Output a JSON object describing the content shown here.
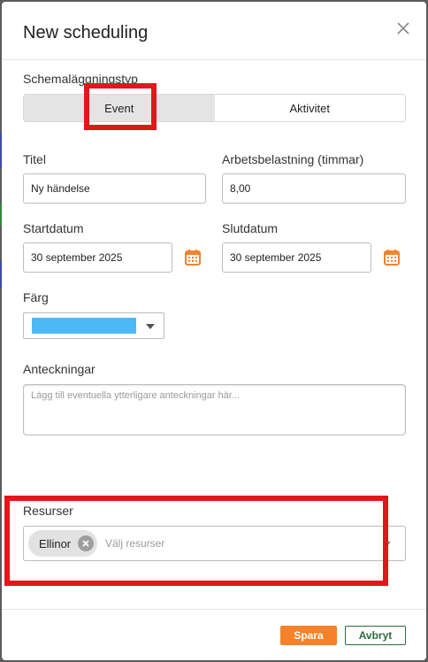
{
  "dialog": {
    "title": "New scheduling"
  },
  "schedule_type": {
    "label": "Schemaläggningstyp",
    "options": [
      "Event",
      "Aktivitet"
    ],
    "selected": "Event"
  },
  "title_field": {
    "label": "Titel",
    "value": "Ny händelse"
  },
  "workload_field": {
    "label": "Arbetsbelastning (timmar)",
    "value": "8,00"
  },
  "start_date_field": {
    "label": "Startdatum",
    "value": "30 september 2025"
  },
  "end_date_field": {
    "label": "Slutdatum",
    "value": "30 september 2025"
  },
  "color_field": {
    "label": "Färg",
    "selected_color": "#4db8f6"
  },
  "notes_field": {
    "label": "Anteckningar",
    "placeholder": "Lägg till eventuella ytterligare anteckningar här..."
  },
  "resources_field": {
    "label": "Resurser",
    "chips": [
      "Ellinor"
    ],
    "placeholder": "Välj resurser"
  },
  "footer": {
    "save_label": "Spara",
    "cancel_label": "Avbryt"
  },
  "colors": {
    "accent_orange": "#f5822a",
    "cancel_green": "#2e6b3e",
    "highlight_red": "#e3171b"
  }
}
